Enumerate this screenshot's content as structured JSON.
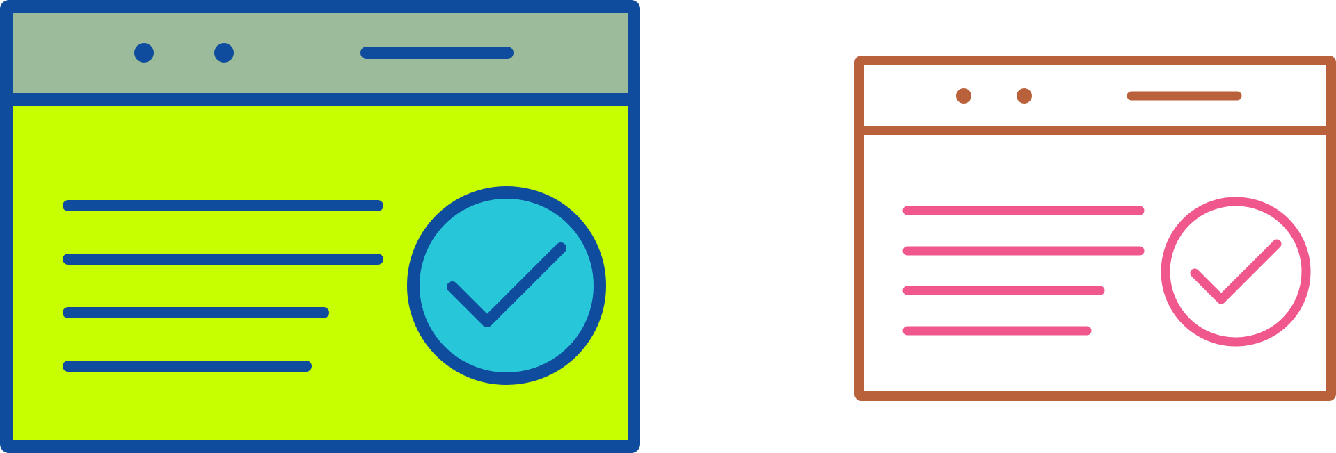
{
  "icons": [
    {
      "name": "browser-window-check-icon",
      "style": "filled",
      "colors": {
        "outline": "#0F4C9E",
        "header_fill": "#9BBB9A",
        "body_fill": "#C7FF00",
        "badge_fill": "#27C6D9",
        "text_lines": "#0F4C9E",
        "check": "#0F4C9E"
      }
    },
    {
      "name": "browser-window-check-icon",
      "style": "outline",
      "colors": {
        "outline": "#B9613A",
        "header_fill": "#FFFFFF",
        "body_fill": "#FFFFFF",
        "badge_fill": "#FFFFFF",
        "text_lines": "#F0578C",
        "check": "#F0578C"
      }
    }
  ]
}
